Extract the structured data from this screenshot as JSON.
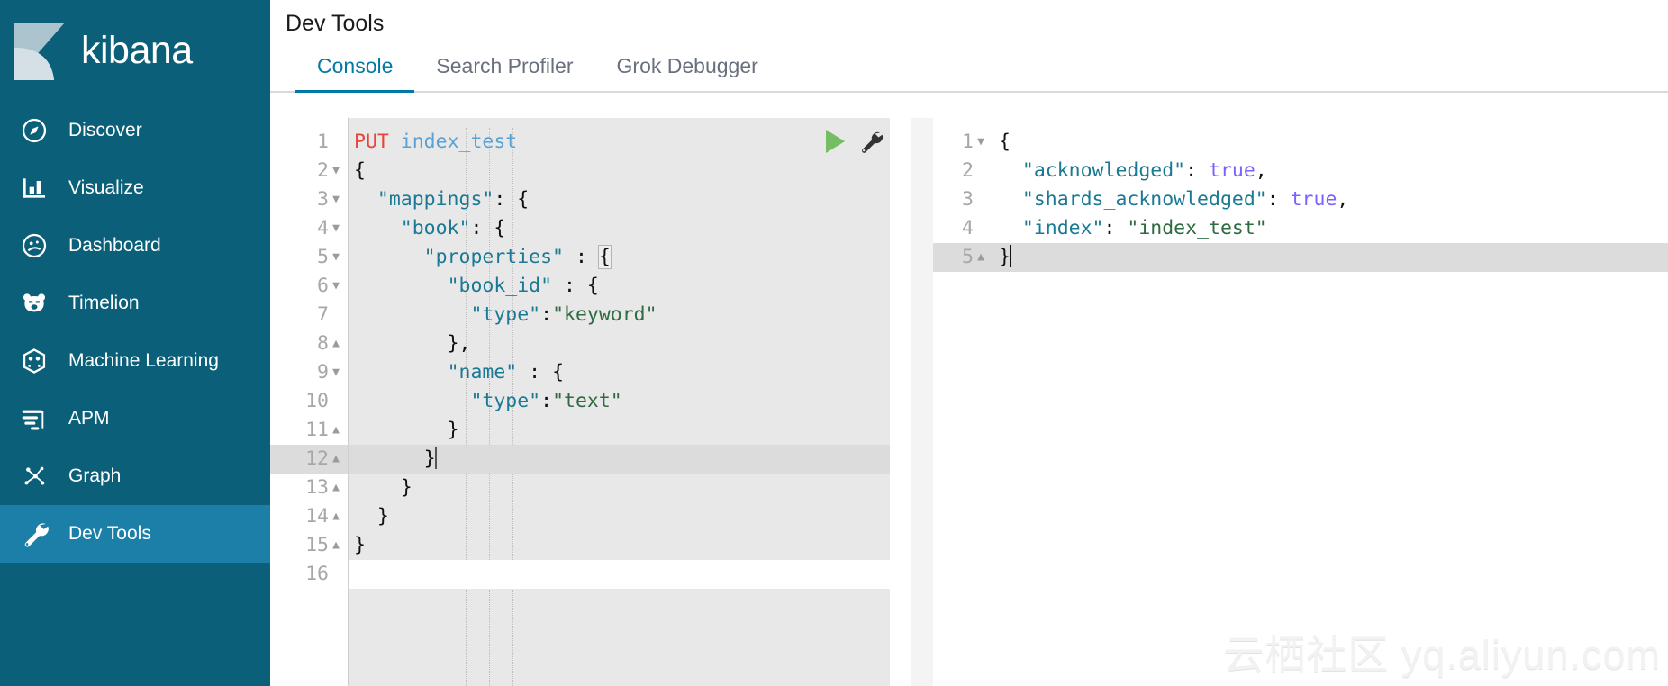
{
  "brand": {
    "name": "kibana",
    "logo_icon": "kibana-logo"
  },
  "sidebar": {
    "items": [
      {
        "label": "Discover",
        "icon": "compass-icon",
        "active": false
      },
      {
        "label": "Visualize",
        "icon": "bar-chart-icon",
        "active": false
      },
      {
        "label": "Dashboard",
        "icon": "dashboard-icon",
        "active": false
      },
      {
        "label": "Timelion",
        "icon": "timelion-bear-icon",
        "active": false
      },
      {
        "label": "Machine Learning",
        "icon": "machine-learning-icon",
        "active": false
      },
      {
        "label": "APM",
        "icon": "apm-lines-icon",
        "active": false
      },
      {
        "label": "Graph",
        "icon": "graph-nodes-icon",
        "active": false
      },
      {
        "label": "Dev Tools",
        "icon": "wrench-icon",
        "active": true
      }
    ]
  },
  "header": {
    "title": "Dev Tools"
  },
  "tabs": [
    {
      "label": "Console",
      "active": true
    },
    {
      "label": "Search Profiler",
      "active": false
    },
    {
      "label": "Grok Debugger",
      "active": false
    }
  ],
  "toolbar": {
    "play_label": "▶",
    "wrench_label": "wrench"
  },
  "request_editor": {
    "current_line": 12,
    "lines": [
      {
        "n": 1,
        "fold": "",
        "tokens": [
          {
            "t": "method",
            "v": "PUT"
          },
          {
            "t": "plain",
            "v": " "
          },
          {
            "t": "url",
            "v": "index_test"
          }
        ]
      },
      {
        "n": 2,
        "fold": "v",
        "tokens": [
          {
            "t": "brace",
            "v": "{"
          }
        ]
      },
      {
        "n": 3,
        "fold": "v",
        "tokens": [
          {
            "t": "plain",
            "v": "  "
          },
          {
            "t": "key",
            "v": "\"mappings\""
          },
          {
            "t": "punct",
            "v": ": "
          },
          {
            "t": "brace",
            "v": "{"
          }
        ]
      },
      {
        "n": 4,
        "fold": "v",
        "tokens": [
          {
            "t": "plain",
            "v": "    "
          },
          {
            "t": "key",
            "v": "\"book\""
          },
          {
            "t": "punct",
            "v": ": "
          },
          {
            "t": "brace",
            "v": "{"
          }
        ]
      },
      {
        "n": 5,
        "fold": "v",
        "tokens": [
          {
            "t": "plain",
            "v": "      "
          },
          {
            "t": "key",
            "v": "\"properties\""
          },
          {
            "t": "punct",
            "v": " : "
          },
          {
            "t": "boxed",
            "v": "{"
          }
        ]
      },
      {
        "n": 6,
        "fold": "v",
        "tokens": [
          {
            "t": "plain",
            "v": "        "
          },
          {
            "t": "key",
            "v": "\"book_id\""
          },
          {
            "t": "punct",
            "v": " : "
          },
          {
            "t": "brace",
            "v": "{"
          }
        ]
      },
      {
        "n": 7,
        "fold": "",
        "tokens": [
          {
            "t": "plain",
            "v": "          "
          },
          {
            "t": "key",
            "v": "\"type\""
          },
          {
            "t": "punct",
            "v": ":"
          },
          {
            "t": "str",
            "v": "\"keyword\""
          }
        ]
      },
      {
        "n": 8,
        "fold": "^",
        "tokens": [
          {
            "t": "plain",
            "v": "        "
          },
          {
            "t": "brace",
            "v": "}"
          },
          {
            "t": "punct",
            "v": ","
          }
        ]
      },
      {
        "n": 9,
        "fold": "v",
        "tokens": [
          {
            "t": "plain",
            "v": "        "
          },
          {
            "t": "key",
            "v": "\"name\""
          },
          {
            "t": "punct",
            "v": " : "
          },
          {
            "t": "brace",
            "v": "{"
          }
        ]
      },
      {
        "n": 10,
        "fold": "",
        "tokens": [
          {
            "t": "plain",
            "v": "          "
          },
          {
            "t": "key",
            "v": "\"type\""
          },
          {
            "t": "punct",
            "v": ":"
          },
          {
            "t": "str",
            "v": "\"text\""
          }
        ]
      },
      {
        "n": 11,
        "fold": "^",
        "tokens": [
          {
            "t": "plain",
            "v": "        "
          },
          {
            "t": "brace",
            "v": "}"
          }
        ]
      },
      {
        "n": 12,
        "fold": "^",
        "tokens": [
          {
            "t": "plain",
            "v": "      "
          },
          {
            "t": "brace",
            "v": "}"
          }
        ]
      },
      {
        "n": 13,
        "fold": "^",
        "tokens": [
          {
            "t": "plain",
            "v": "    "
          },
          {
            "t": "brace",
            "v": "}"
          }
        ]
      },
      {
        "n": 14,
        "fold": "^",
        "tokens": [
          {
            "t": "plain",
            "v": "  "
          },
          {
            "t": "brace",
            "v": "}"
          }
        ]
      },
      {
        "n": 15,
        "fold": "^",
        "tokens": [
          {
            "t": "brace",
            "v": "}"
          }
        ]
      },
      {
        "n": 16,
        "fold": "",
        "tokens": []
      }
    ]
  },
  "response_editor": {
    "current_line": 5,
    "lines": [
      {
        "n": 1,
        "fold": "v",
        "tokens": [
          {
            "t": "brace",
            "v": "{"
          }
        ]
      },
      {
        "n": 2,
        "fold": "",
        "tokens": [
          {
            "t": "plain",
            "v": "  "
          },
          {
            "t": "key",
            "v": "\"acknowledged\""
          },
          {
            "t": "punct",
            "v": ": "
          },
          {
            "t": "bool",
            "v": "true"
          },
          {
            "t": "punct",
            "v": ","
          }
        ]
      },
      {
        "n": 3,
        "fold": "",
        "tokens": [
          {
            "t": "plain",
            "v": "  "
          },
          {
            "t": "key",
            "v": "\"shards_acknowledged\""
          },
          {
            "t": "punct",
            "v": ": "
          },
          {
            "t": "bool",
            "v": "true"
          },
          {
            "t": "punct",
            "v": ","
          }
        ]
      },
      {
        "n": 4,
        "fold": "",
        "tokens": [
          {
            "t": "plain",
            "v": "  "
          },
          {
            "t": "key",
            "v": "\"index\""
          },
          {
            "t": "punct",
            "v": ": "
          },
          {
            "t": "str",
            "v": "\"index_test\""
          }
        ]
      },
      {
        "n": 5,
        "fold": "^",
        "tokens": [
          {
            "t": "brace",
            "v": "}"
          }
        ]
      }
    ]
  },
  "watermark": {
    "text": "云栖社区 yq.aliyun.com"
  },
  "colors": {
    "sidebar_bg": "#0b5f78",
    "sidebar_active": "#1b7fa8",
    "accent": "#0079a5",
    "editor_bg": "#e8e8e8",
    "active_line": "#dcdcdc",
    "method": "#e8443a",
    "url": "#58a3d4",
    "key": "#1a7994",
    "string": "#2f6b42",
    "boolean": "#7b61ff",
    "play_green": "#74bd62"
  }
}
